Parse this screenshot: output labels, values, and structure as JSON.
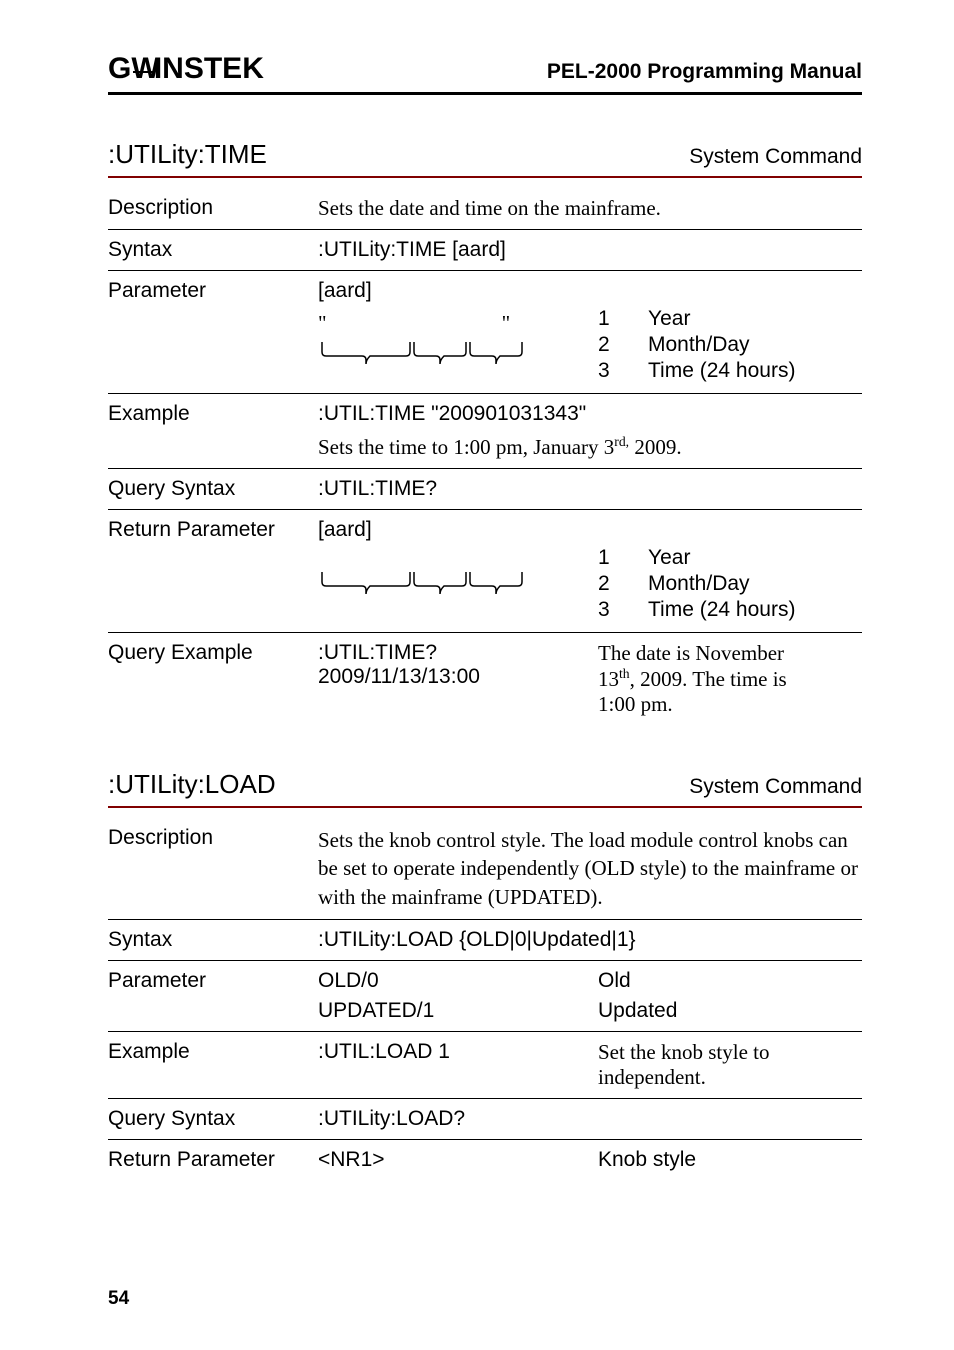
{
  "header": {
    "logo": "G凹INSTEK",
    "manual_title": "PEL-2000 Programming Manual"
  },
  "section1": {
    "heading": ":UTILity:TIME",
    "type": "System Command",
    "description_label": "Description",
    "description": "Sets the date and time on the mainframe.",
    "syntax_label": "Syntax",
    "syntax": ":UTILity:TIME [aard]",
    "parameter_label": "Parameter",
    "parameter_name": "[aard]",
    "param_items": [
      {
        "n": "1",
        "t": "Year"
      },
      {
        "n": "2",
        "t": "Month/Day"
      },
      {
        "n": "3",
        "t": "Time (24 hours)"
      }
    ],
    "example_label": "Example",
    "example_cmd": ":UTIL:TIME \"200901031343\"",
    "example_desc": "Sets the time to 1:00 pm, January 3rd, 2009.",
    "qsyntax_label": "Query Syntax",
    "qsyntax": ":UTIL:TIME?",
    "retparam_label": "Return Parameter",
    "retparam_name": "[aard]",
    "qexample_label": "Query Example",
    "qexample_cmd": ":UTIL:TIME?",
    "qexample_val": "2009/11/13/13:00",
    "qexample_desc1": "The date is November",
    "qexample_desc2": "13th, 2009. The time is",
    "qexample_desc3": "1:00 pm."
  },
  "section2": {
    "heading": ":UTILity:LOAD",
    "type": "System Command",
    "description_label": "Description",
    "description": "Sets the knob control style. The load module control knobs can be set to operate independently (OLD style) to the mainframe or with the mainframe (UPDATED).",
    "syntax_label": "Syntax",
    "syntax": ":UTILity:LOAD {OLD|0|Updated|1}",
    "parameter_label": "Parameter",
    "param1_key": "OLD/0",
    "param1_val": "Old",
    "param2_key": "UPDATED/1",
    "param2_val": "Updated",
    "example_label": "Example",
    "example_cmd": ":UTIL:LOAD 1",
    "example_desc": "Set the knob style to independent.",
    "qsyntax_label": "Query Syntax",
    "qsyntax": ":UTILity:LOAD?",
    "retparam_label": "Return Parameter",
    "retparam_key": "<NR1>",
    "retparam_val": "Knob style"
  },
  "page_number": "54"
}
